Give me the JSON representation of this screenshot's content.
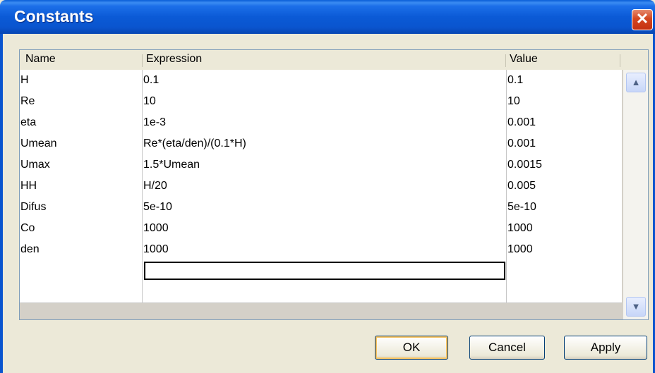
{
  "window": {
    "title": "Constants",
    "close_icon": "close-icon"
  },
  "table": {
    "columns": [
      "Name",
      "Expression",
      "Value"
    ],
    "rows": [
      {
        "name": "H",
        "expression": "0.1",
        "value": "0.1"
      },
      {
        "name": "Re",
        "expression": "10",
        "value": "10"
      },
      {
        "name": "eta",
        "expression": "1e-3",
        "value": "0.001"
      },
      {
        "name": "Umean",
        "expression": "Re*(eta/den)/(0.1*H)",
        "value": "0.001"
      },
      {
        "name": "Umax",
        "expression": "1.5*Umean",
        "value": "0.0015"
      },
      {
        "name": "HH",
        "expression": "H/20",
        "value": "0.005"
      },
      {
        "name": "Difus",
        "expression": "5e-10",
        "value": "5e-10"
      },
      {
        "name": "Co",
        "expression": "1000",
        "value": "1000"
      },
      {
        "name": "den",
        "expression": "1000",
        "value": "1000"
      },
      {
        "name": "",
        "expression": "",
        "value": ""
      },
      {
        "name": "",
        "expression": "",
        "value": ""
      }
    ]
  },
  "buttons": {
    "ok": "OK",
    "cancel": "Cancel",
    "apply": "Apply"
  },
  "colors": {
    "titlebar": "#0a55cf",
    "dialog_bg": "#ece9d8",
    "close": "#d4461f"
  }
}
